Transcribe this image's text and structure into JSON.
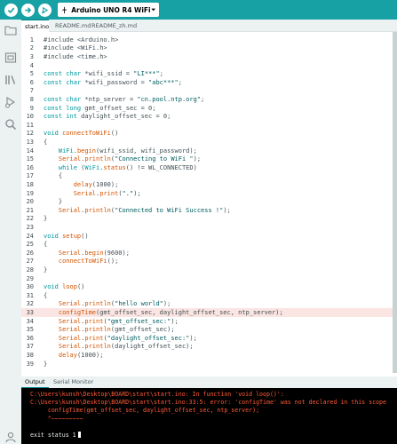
{
  "toolbar": {
    "board_label": "Arduino UNO R4 WiFi",
    "colors": {
      "bar": "#17a1a5"
    }
  },
  "tabs": [
    {
      "label": "start.ino",
      "active": true
    },
    {
      "label": "README.md",
      "active": false
    },
    {
      "label": "README_zh.md",
      "active": false
    }
  ],
  "sidebar": {
    "icons": [
      "folder-icon",
      "board-icon",
      "library-icon",
      "debug-icon",
      "search-icon"
    ]
  },
  "editor": {
    "highlight_line": 33,
    "lines": [
      {
        "n": "1",
        "segs": [
          [
            "code",
            "#include <Arduino.h>"
          ]
        ]
      },
      {
        "n": "2",
        "segs": [
          [
            "code",
            "#include <WiFi.h>"
          ]
        ]
      },
      {
        "n": "3",
        "segs": [
          [
            "code",
            "#include <time.h>"
          ]
        ]
      },
      {
        "n": "4",
        "segs": []
      },
      {
        "n": "5",
        "segs": [
          [
            "kw",
            "const char"
          ],
          [
            "code",
            " *wifi_ssid = "
          ],
          [
            "str",
            "\"LI***\""
          ],
          [
            "code",
            ";"
          ]
        ]
      },
      {
        "n": "6",
        "segs": [
          [
            "kw",
            "const char"
          ],
          [
            "code",
            " *wifi_password = "
          ],
          [
            "str",
            "\"abc***\""
          ],
          [
            "code",
            ";"
          ]
        ]
      },
      {
        "n": "7",
        "segs": []
      },
      {
        "n": "8",
        "segs": [
          [
            "kw",
            "const char"
          ],
          [
            "code",
            " *ntp_server = "
          ],
          [
            "str",
            "\"cn.pool.ntp.org\""
          ],
          [
            "code",
            ";"
          ]
        ]
      },
      {
        "n": "9",
        "segs": [
          [
            "kw",
            "const long"
          ],
          [
            "code",
            " gmt_offset_sec = 0;"
          ]
        ]
      },
      {
        "n": "10",
        "segs": [
          [
            "kw",
            "const int"
          ],
          [
            "code",
            " daylight_offset_sec = 0;"
          ]
        ]
      },
      {
        "n": "11",
        "segs": []
      },
      {
        "n": "12",
        "segs": [
          [
            "kw",
            "void"
          ],
          [
            "code",
            " "
          ],
          [
            "fn",
            "connectToWiFi"
          ],
          [
            "code",
            "()"
          ]
        ]
      },
      {
        "n": "13",
        "segs": [
          [
            "code",
            "{"
          ]
        ]
      },
      {
        "n": "14",
        "segs": [
          [
            "code",
            "    "
          ],
          [
            "kw",
            "WiFi"
          ],
          [
            "code",
            "."
          ],
          [
            "fn",
            "begin"
          ],
          [
            "code",
            "(wifi_ssid, wifi_password);"
          ]
        ]
      },
      {
        "n": "15",
        "segs": [
          [
            "code",
            "    "
          ],
          [
            "fn",
            "Serial"
          ],
          [
            "code",
            "."
          ],
          [
            "fn",
            "println"
          ],
          [
            "code",
            "("
          ],
          [
            "str",
            "\"Connecting to WiFi \""
          ],
          [
            "code",
            ");"
          ]
        ]
      },
      {
        "n": "16",
        "segs": [
          [
            "code",
            "    "
          ],
          [
            "kw",
            "while"
          ],
          [
            "code",
            " ("
          ],
          [
            "kw",
            "WiFi"
          ],
          [
            "code",
            "."
          ],
          [
            "fn",
            "status"
          ],
          [
            "code",
            "() != WL_CONNECTED)"
          ]
        ]
      },
      {
        "n": "17",
        "segs": [
          [
            "code",
            "    {"
          ]
        ]
      },
      {
        "n": "18",
        "segs": [
          [
            "code",
            "        "
          ],
          [
            "fn",
            "delay"
          ],
          [
            "code",
            "(1000);"
          ]
        ]
      },
      {
        "n": "19",
        "segs": [
          [
            "code",
            "        "
          ],
          [
            "fn",
            "Serial"
          ],
          [
            "code",
            "."
          ],
          [
            "fn",
            "print"
          ],
          [
            "code",
            "("
          ],
          [
            "str",
            "\".\""
          ],
          [
            "code",
            ");"
          ]
        ]
      },
      {
        "n": "20",
        "segs": [
          [
            "code",
            "    }"
          ]
        ]
      },
      {
        "n": "21",
        "segs": [
          [
            "code",
            "    "
          ],
          [
            "fn",
            "Serial"
          ],
          [
            "code",
            "."
          ],
          [
            "fn",
            "println"
          ],
          [
            "code",
            "("
          ],
          [
            "str",
            "\"Connected to WiFi Success !\""
          ],
          [
            "code",
            ");"
          ]
        ]
      },
      {
        "n": "22",
        "segs": [
          [
            "code",
            "}"
          ]
        ]
      },
      {
        "n": "23",
        "segs": []
      },
      {
        "n": "24",
        "segs": [
          [
            "kw",
            "void"
          ],
          [
            "code",
            " "
          ],
          [
            "fn",
            "setup"
          ],
          [
            "code",
            "()"
          ]
        ]
      },
      {
        "n": "25",
        "segs": [
          [
            "code",
            "{"
          ]
        ]
      },
      {
        "n": "26",
        "segs": [
          [
            "code",
            "    "
          ],
          [
            "fn",
            "Serial"
          ],
          [
            "code",
            "."
          ],
          [
            "fn",
            "begin"
          ],
          [
            "code",
            "(9600);"
          ]
        ]
      },
      {
        "n": "27",
        "segs": [
          [
            "code",
            "    "
          ],
          [
            "fn",
            "connectToWiFi"
          ],
          [
            "code",
            "();"
          ]
        ]
      },
      {
        "n": "28",
        "segs": [
          [
            "code",
            "}"
          ]
        ]
      },
      {
        "n": "29",
        "segs": []
      },
      {
        "n": "30",
        "segs": [
          [
            "kw",
            "void"
          ],
          [
            "code",
            " "
          ],
          [
            "fn",
            "loop"
          ],
          [
            "code",
            "()"
          ]
        ]
      },
      {
        "n": "31",
        "segs": [
          [
            "code",
            "{"
          ]
        ]
      },
      {
        "n": "32",
        "segs": [
          [
            "code",
            "    "
          ],
          [
            "fn",
            "Serial"
          ],
          [
            "code",
            "."
          ],
          [
            "fn",
            "println"
          ],
          [
            "code",
            "("
          ],
          [
            "str",
            "\"hello world\""
          ],
          [
            "code",
            ");"
          ]
        ]
      },
      {
        "n": "33",
        "segs": [
          [
            "code",
            "    "
          ],
          [
            "fn",
            "configTime"
          ],
          [
            "code",
            "(gmt_offset_sec, daylight_offset_sec, ntp_server);"
          ]
        ]
      },
      {
        "n": "34",
        "segs": [
          [
            "code",
            "    "
          ],
          [
            "fn",
            "Serial"
          ],
          [
            "code",
            "."
          ],
          [
            "fn",
            "print"
          ],
          [
            "code",
            "("
          ],
          [
            "str",
            "\"gmt_offset_sec:\""
          ],
          [
            "code",
            ");"
          ]
        ]
      },
      {
        "n": "35",
        "segs": [
          [
            "code",
            "    "
          ],
          [
            "fn",
            "Serial"
          ],
          [
            "code",
            "."
          ],
          [
            "fn",
            "println"
          ],
          [
            "code",
            "(gmt_offset_sec);"
          ]
        ]
      },
      {
        "n": "36",
        "segs": [
          [
            "code",
            "    "
          ],
          [
            "fn",
            "Serial"
          ],
          [
            "code",
            "."
          ],
          [
            "fn",
            "print"
          ],
          [
            "code",
            "("
          ],
          [
            "str",
            "\"daylight_offset_sec:\""
          ],
          [
            "code",
            ");"
          ]
        ]
      },
      {
        "n": "37",
        "segs": [
          [
            "code",
            "    "
          ],
          [
            "fn",
            "Serial"
          ],
          [
            "code",
            "."
          ],
          [
            "fn",
            "println"
          ],
          [
            "code",
            "(daylight_offset_sec);"
          ]
        ]
      },
      {
        "n": "38",
        "segs": [
          [
            "code",
            "    "
          ],
          [
            "fn",
            "delay"
          ],
          [
            "code",
            "(1000);"
          ]
        ]
      },
      {
        "n": "39",
        "segs": [
          [
            "code",
            "}"
          ]
        ]
      }
    ]
  },
  "panel": {
    "tabs": [
      {
        "label": "Output",
        "active": true
      },
      {
        "label": "Serial Monitor",
        "active": false
      }
    ],
    "output_lines": [
      {
        "text": "C:\\Users\\kunsh\\Desktop\\BOARD\\start\\start.ino: In function 'void loop()':",
        "color": "error"
      },
      {
        "text": "C:\\Users\\kunsh\\Desktop\\BOARD\\start\\start.ino:33:5: error: 'configTime' was not declared in this scope",
        "color": "error"
      },
      {
        "text": "     configTime(gmt_offset_sec, daylight_offset_sec, ntp_server);",
        "color": "error"
      },
      {
        "text": "     ^~~~~~~~~~",
        "color": "error"
      },
      {
        "text": "",
        "color": "error"
      },
      {
        "text": "exit status 1",
        "color": "white"
      }
    ]
  }
}
